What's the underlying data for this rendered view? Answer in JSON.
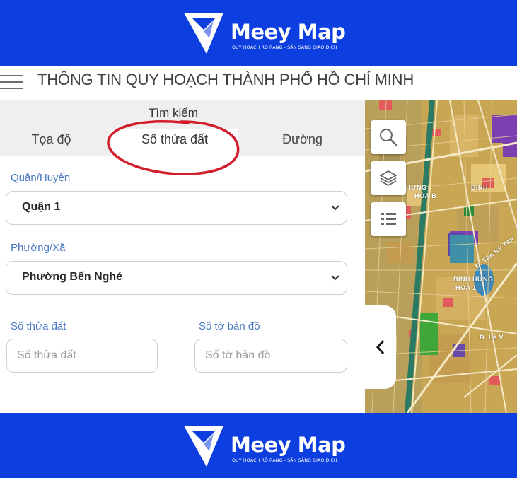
{
  "brand": {
    "name": "Meey Map",
    "tagline": "QUY HOẠCH RÕ RÀNG - SẴN SÀNG GIAO DỊCH"
  },
  "header": {
    "title": "THÔNG TIN QUY HOẠCH THÀNH PHỐ HỒ CHÍ MINH"
  },
  "search": {
    "caption": "Tìm kiếm",
    "tabs": [
      {
        "label": "Tọa độ"
      },
      {
        "label": "Số thửa đất"
      },
      {
        "label": "Đường"
      }
    ],
    "active_tab": "Số thửa đất",
    "district": {
      "label": "Quận/Huyện",
      "value": "Quận 1"
    },
    "ward": {
      "label": "Phường/Xã",
      "value": "Phường Bến Nghé"
    },
    "parcel": {
      "label": "Số thửa đất",
      "placeholder": "Số thửa đất"
    },
    "sheet": {
      "label": "Số tờ bản đồ",
      "placeholder": "Số tờ bản đồ"
    }
  },
  "map": {
    "labels": [
      "HƯNG",
      "HÒA B",
      "BÌNH",
      "BÌNH HƯNG",
      "HÒA 1",
      "Đ. Lê V",
      "Đ. Tân Kỳ Tân"
    ]
  },
  "colors": {
    "banner": "#0c3ee0",
    "annotation": "#d21e2b",
    "label": "#4a78c4"
  }
}
